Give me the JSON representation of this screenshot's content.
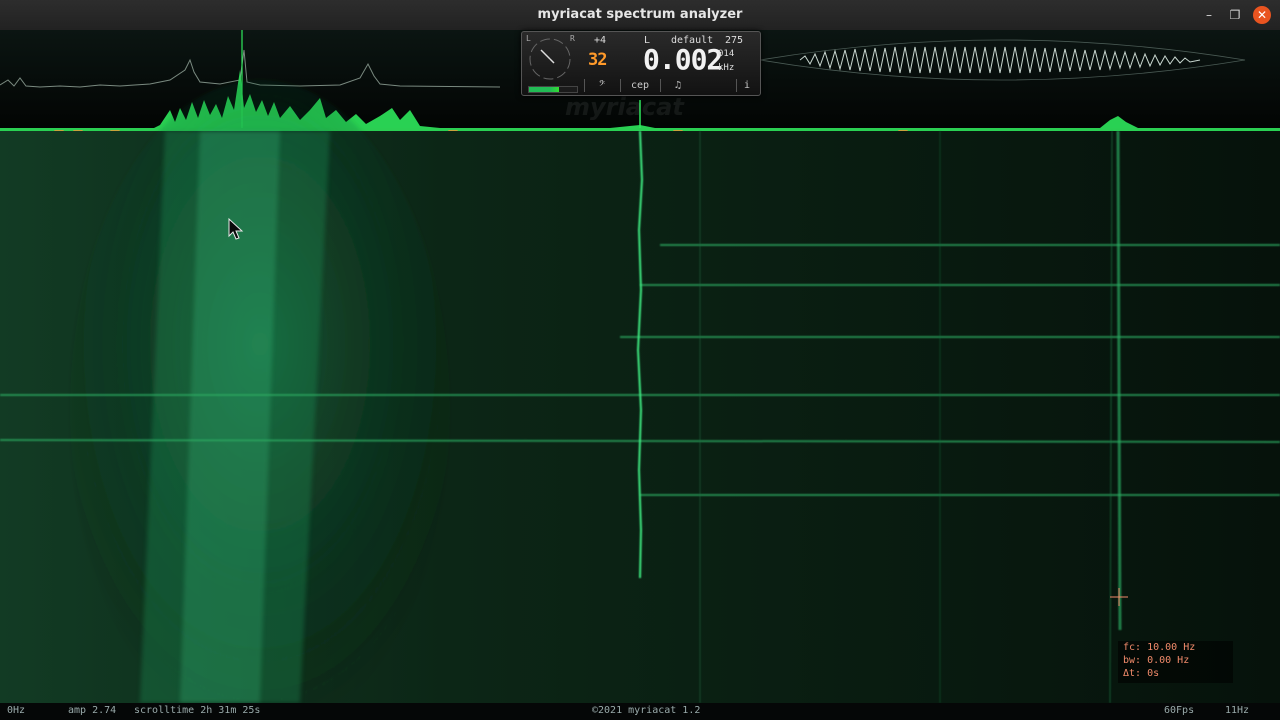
{
  "window": {
    "title": "myriacat spectrum analyzer",
    "controls": {
      "minimize": "–",
      "maximize": "❐",
      "close": "✕"
    }
  },
  "hud": {
    "lr_left": "L",
    "lr_right": "R",
    "transpose": "+4",
    "octave": "32",
    "channel": "L",
    "preset": "default",
    "value_275": "275",
    "frequency": "0.002",
    "cents": "014",
    "unit": "kHz",
    "buttons": [
      "𝄢",
      "cep",
      "♫",
      "i"
    ],
    "meter_level": 0.62
  },
  "watermark": "myriacat",
  "cursor_readout": {
    "fc": "fc: 10.00 Hz",
    "bw": "bw: 0.00 Hz",
    "dt": "Δt: 0s"
  },
  "statusbar": {
    "left_freq": "0Hz",
    "amp": "amp 2.74",
    "scrolltime": "scrolltime 2h 31m 25s",
    "copyright": "©2021 myriacat 1.2",
    "fps": "60Fps",
    "right_freq": "11Hz"
  },
  "colors": {
    "accent": "#2ee85c",
    "spectrogram": "#1f9e5a",
    "marker": "#c9a23a",
    "readout": "#f08a6a",
    "close_button": "#e95420"
  },
  "icons": {
    "close": "close-icon",
    "maximize": "maximize-icon",
    "minimize": "minimize-icon",
    "mouse_pointer": "pointer-cursor-icon",
    "crosshair": "crosshair-cursor-icon"
  }
}
